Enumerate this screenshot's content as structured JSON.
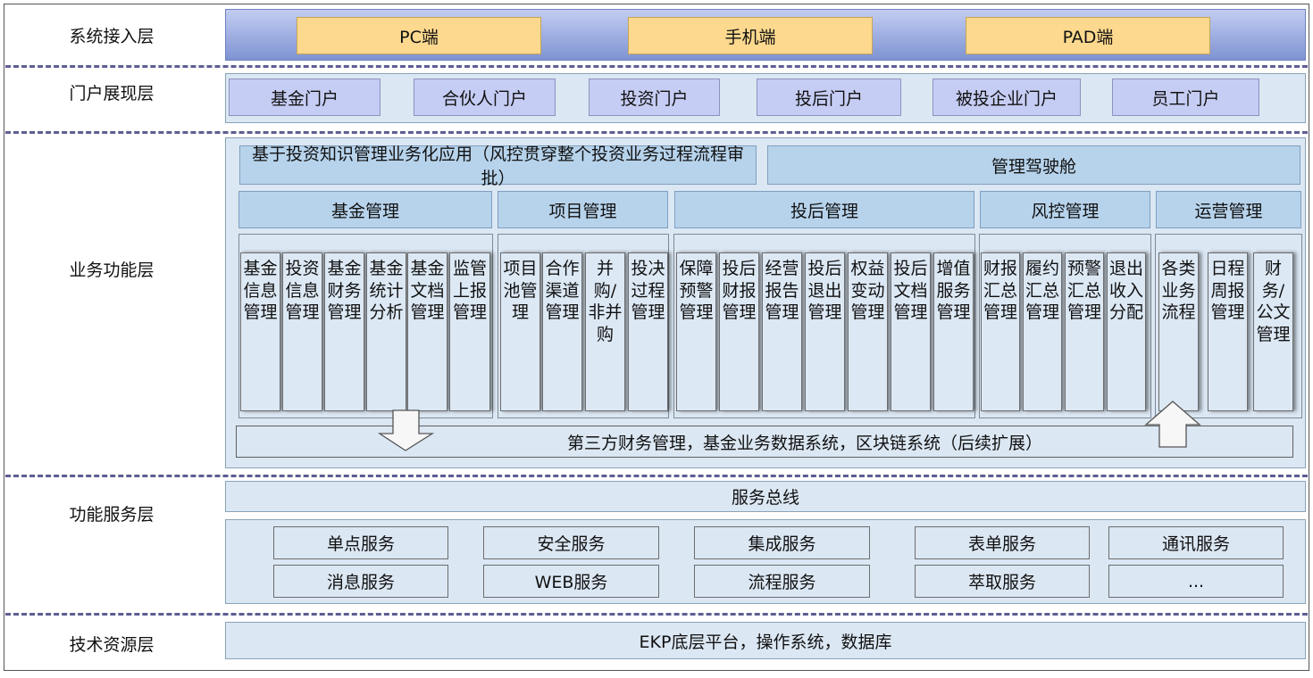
{
  "layers": {
    "access": "系统接入层",
    "portal": "门户展现层",
    "business": "业务功能层",
    "service": "功能服务层",
    "tech": "技术资源层"
  },
  "access": [
    "PC端",
    "手机端",
    "PAD端"
  ],
  "portals": [
    "基金门户",
    "合伙人门户",
    "投资门户",
    "投后门户",
    "被投企业门户",
    "员工门户"
  ],
  "business": {
    "knowledge_app": "基于投资知识管理业务化应用（风控贯穿整个投资业务过程流程审批）",
    "cockpit": "管理驾驶舱",
    "groups": [
      {
        "title": "基金管理",
        "items": [
          "基金信息管理",
          "投资信息管理",
          "基金财务管理",
          "基金统计分析",
          "基金文档管理",
          "监管上报管理"
        ]
      },
      {
        "title": "项目管理",
        "items": [
          "项目池管理",
          "合作渠道管理",
          "并购/非并购",
          "投决过程管理"
        ]
      },
      {
        "title": "投后管理",
        "items": [
          "保障预警管理",
          "投后财报管理",
          "经营报告管理",
          "投后退出管理",
          "权益变动管理",
          "投后文档管理",
          "增值服务管理"
        ]
      },
      {
        "title": "风控管理",
        "items": [
          "财报汇总管理",
          "履约汇总管理",
          "预警汇总管理",
          "退出收入分配"
        ]
      },
      {
        "title": "运营管理",
        "items": [
          "各类业务流程",
          "日程周报管理",
          "财务/公文管理"
        ]
      }
    ],
    "third_party": "第三方财务管理，基金业务数据系统，区块链系统（后续扩展）"
  },
  "service": {
    "bus": "服务总线",
    "items": [
      "单点服务",
      "安全服务",
      "集成服务",
      "表单服务",
      "通讯服务",
      "消息服务",
      "WEB服务",
      "流程服务",
      "萃取服务",
      "..."
    ]
  },
  "tech": {
    "platform": "EKP底层平台，操作系统，数据库"
  }
}
